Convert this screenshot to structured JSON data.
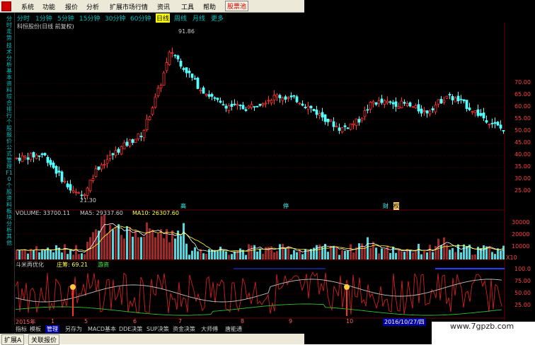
{
  "menu": {
    "items": [
      "系统",
      "功能",
      "报价",
      "分析",
      "扩展市场行情",
      "资讯",
      "工具",
      "帮助"
    ],
    "highlight": "股票池"
  },
  "periods": {
    "items": [
      "分时",
      "1分钟",
      "5分钟",
      "15分钟",
      "30分钟",
      "60分钟",
      "日线",
      "周线",
      "月线",
      "更多"
    ],
    "active": "日线"
  },
  "sidebar": {
    "items": [
      "分时走势",
      "技术分析",
      "基本资料",
      "综合排行",
      "个股报价",
      "公式管理",
      "F10",
      "个股资料",
      "板块分析",
      "其他"
    ]
  },
  "chart_title": "科恒股份(日线 前复权)",
  "price_labels": {
    "high": "91.86",
    "low": "21.30",
    "axis": [
      "70.00",
      "65.00",
      "60.00",
      "55.00",
      "50.00",
      "45.00",
      "40.00",
      "35.00",
      "30.00",
      "25.00"
    ]
  },
  "markers": {
    "m1": "高",
    "m2": "停",
    "m3": "财",
    "m4": "权"
  },
  "volume": {
    "label": "VOLUME: 33700.11",
    "ma5": "MA5: 29337.60",
    "ma10": "MA10: 26307.60",
    "axis": [
      "30000",
      "20000",
      "10000",
      "X10"
    ]
  },
  "indicator": {
    "name": "斗米再优化",
    "label1": "庄筹: 69.21",
    "label2": "游资",
    "axis": [
      "100.0",
      "75.00",
      "50.00",
      "25.00"
    ]
  },
  "dates": [
    "2015年",
    "1",
    "5",
    "6",
    "7",
    "8",
    "9",
    "10",
    "2016/10/27/四"
  ],
  "tabs": {
    "items": [
      "指标",
      "模板",
      "管理",
      "另存为",
      "MACD基本",
      "DDE决策",
      "SUP决策",
      "资金决策",
      "大师傅",
      "唐能通"
    ],
    "active": "管理"
  },
  "bottom": {
    "items": [
      "扩展A",
      "关联报价"
    ]
  },
  "watermark": "www.7gpzb.com",
  "colors": {
    "up": "#ff3232",
    "down": "#54ffff",
    "accent": "#ffff00"
  }
}
